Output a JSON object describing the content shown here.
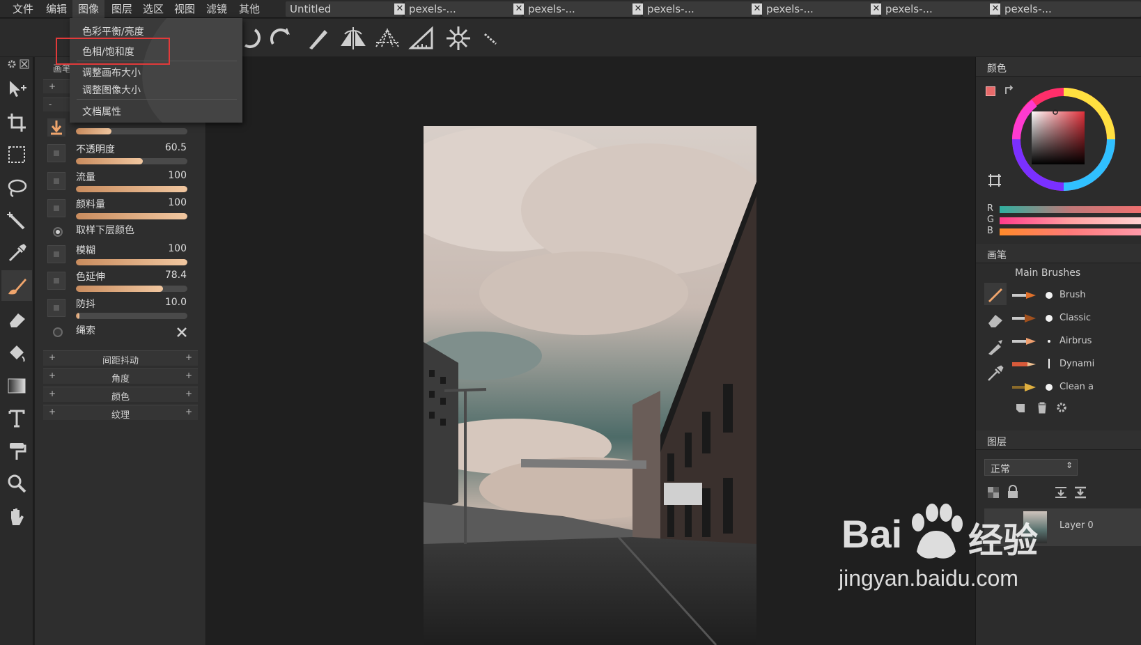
{
  "menubar": {
    "items": [
      "文件",
      "编辑",
      "图像",
      "图层",
      "选区",
      "视图",
      "滤镜",
      "其他"
    ],
    "active_index": 2
  },
  "tabs": [
    {
      "label": "Untitled"
    },
    {
      "label": "pexels-..."
    },
    {
      "label": "pexels-..."
    },
    {
      "label": "pexels-..."
    },
    {
      "label": "pexels-..."
    },
    {
      "label": "pexels-..."
    },
    {
      "label": "pexels-..."
    }
  ],
  "dropdown": {
    "items": [
      "色彩平衡/亮度",
      "色相/饱和度",
      "调整画布大小",
      "调整图像大小",
      "文档属性"
    ],
    "highlighted": "色相/饱和度"
  },
  "brush_panel": {
    "header_fragment": "画笔",
    "rows": [
      {
        "label": "不透明度",
        "value": "60.5",
        "fill": 0.6
      },
      {
        "label": "流量",
        "value": "100",
        "fill": 1.0
      },
      {
        "label": "颜料量",
        "value": "100",
        "fill": 1.0
      },
      {
        "label": "模糊",
        "value": "100",
        "fill": 1.0
      },
      {
        "label": "色延伸",
        "value": "78.4",
        "fill": 0.78
      },
      {
        "label": "防抖",
        "value": "10.0",
        "fill": 0.03
      }
    ],
    "top_row_fill": 0.32,
    "sample_label": "取样下层颜色",
    "lasso_label": "绳索",
    "sections": [
      "间距抖动",
      "角度",
      "颜色",
      "纹理"
    ],
    "plus": "+",
    "minus": "-"
  },
  "color_panel": {
    "title": "颜色",
    "labels": [
      "R",
      "G",
      "B"
    ]
  },
  "brushes_panel": {
    "title": "画笔",
    "set_name": "Main Brushes",
    "brushes": [
      "Brush",
      "Classic",
      "Airbrus",
      "Dynami",
      "Clean a"
    ]
  },
  "layers_panel": {
    "title": "图层",
    "blend_mode": "正常",
    "layer_name": "Layer 0"
  },
  "watermark": {
    "brand": "Bai",
    "brand2": "经验",
    "url": "jingyan.baidu.com"
  },
  "colors": {
    "highlight_red": "#e23a3a",
    "slider_accent": "#f1c7a0",
    "panel_bg": "#2e2e2e"
  }
}
